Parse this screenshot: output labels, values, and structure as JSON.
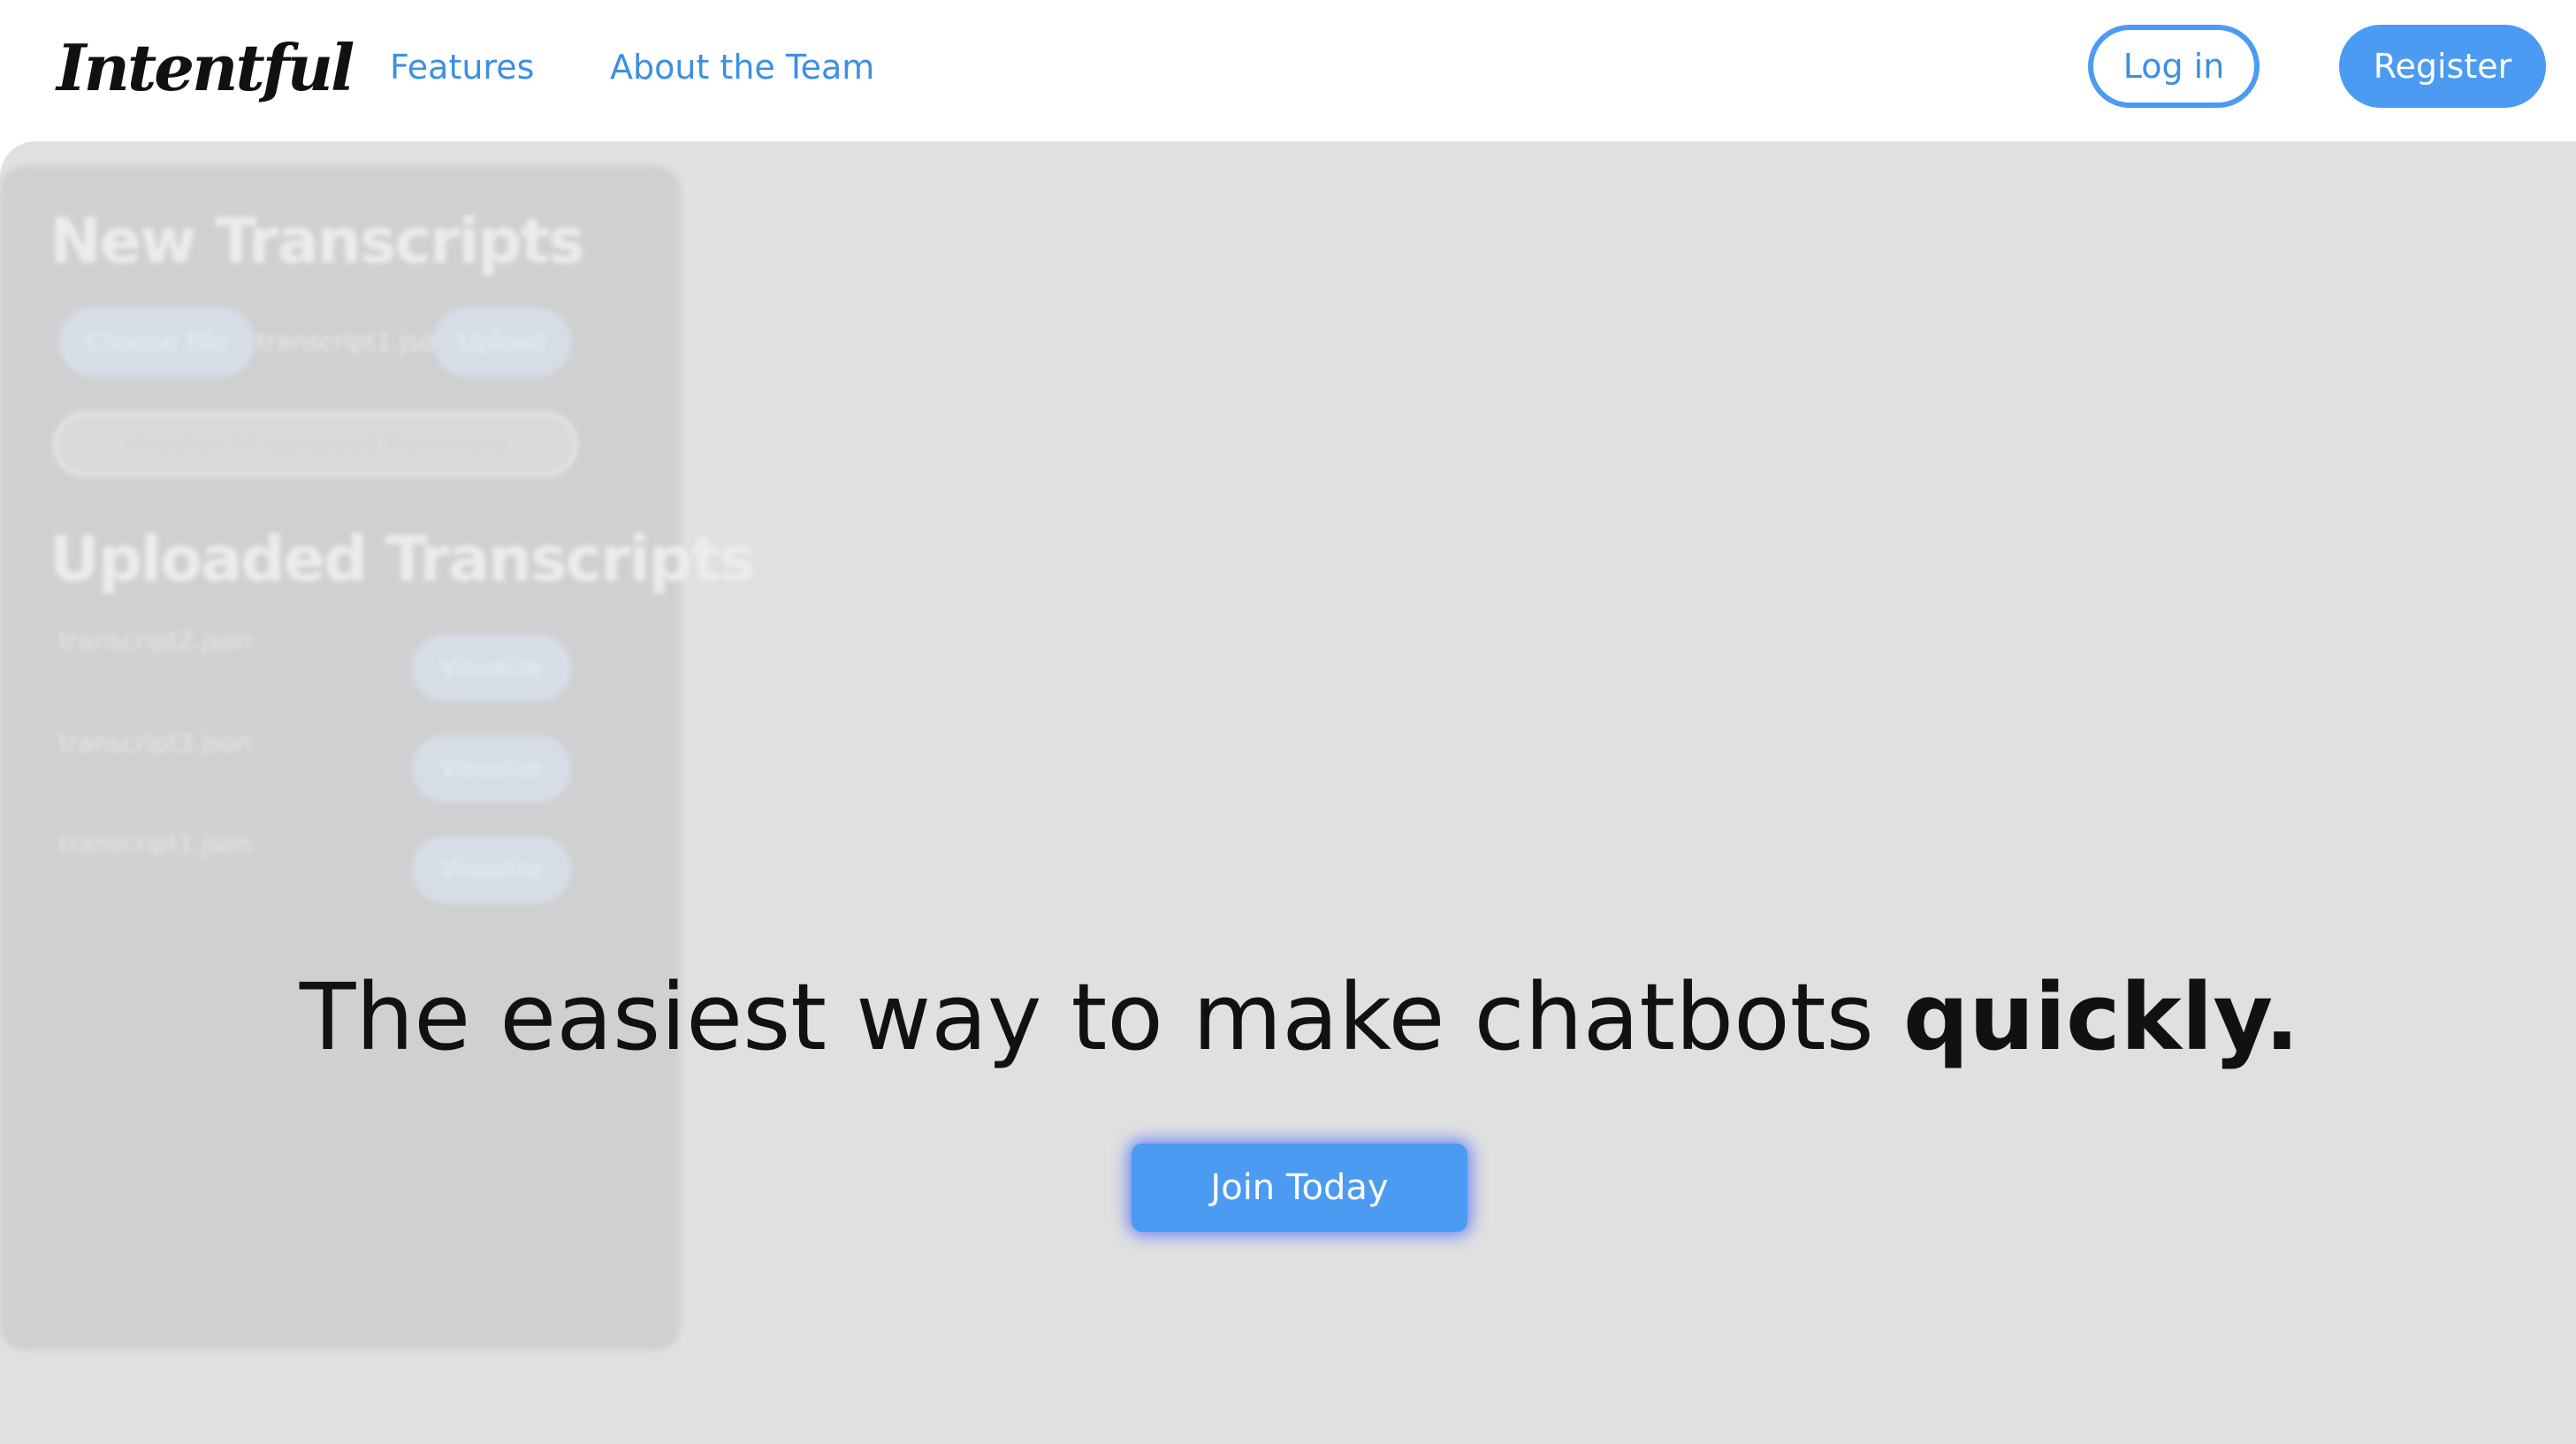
{
  "colors": {
    "accent": "#4a9bf1",
    "hero_background": "#e0e0e0",
    "headline_text": "#111111"
  },
  "nav": {
    "logo": "Intentful",
    "links": [
      "Features",
      "About the Team"
    ],
    "login_label": "Log in",
    "register_label": "Register"
  },
  "preview": {
    "new_heading": "New Transcripts",
    "choose_file_label": "Choose File",
    "selected_file": "transcript1.json",
    "upload_label": "Upload",
    "visualize_all_label": "Visualize All Uploaded Transcripts",
    "uploaded_heading": "Uploaded Transcripts",
    "uploaded": [
      {
        "name": "transcript2.json",
        "action": "Visualize"
      },
      {
        "name": "transcript3.json",
        "action": "Visualize"
      },
      {
        "name": "transcript1.json",
        "action": "Visualize"
      }
    ]
  },
  "hero": {
    "headline_main": "The easiest way to make chatbots ",
    "headline_emphasis": "quickly.",
    "cta_label": "Join Today"
  }
}
